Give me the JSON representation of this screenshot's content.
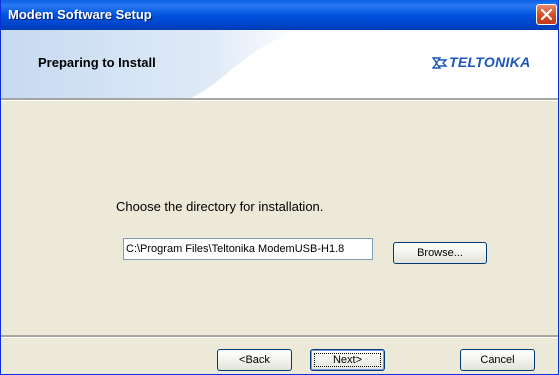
{
  "window": {
    "title": "Modem Software Setup"
  },
  "header": {
    "title": "Preparing to Install",
    "logo_text": "TELTONIKA"
  },
  "main": {
    "prompt": "Choose the directory for installation.",
    "path_value": "C:\\Program Files\\Teltonika ModemUSB-H1.8",
    "browse_label": "Browse..."
  },
  "footer": {
    "back_label": "<Back",
    "next_label": "Next>",
    "cancel_label": "Cancel"
  },
  "colors": {
    "titlebar": "#0053e0",
    "header_swoosh": "#cfe0f4",
    "logo": "#1c56b8",
    "dialog_bg": "#ece9d8"
  },
  "icons": {
    "close": "close-icon",
    "logo": "teltonika-logo-icon"
  }
}
